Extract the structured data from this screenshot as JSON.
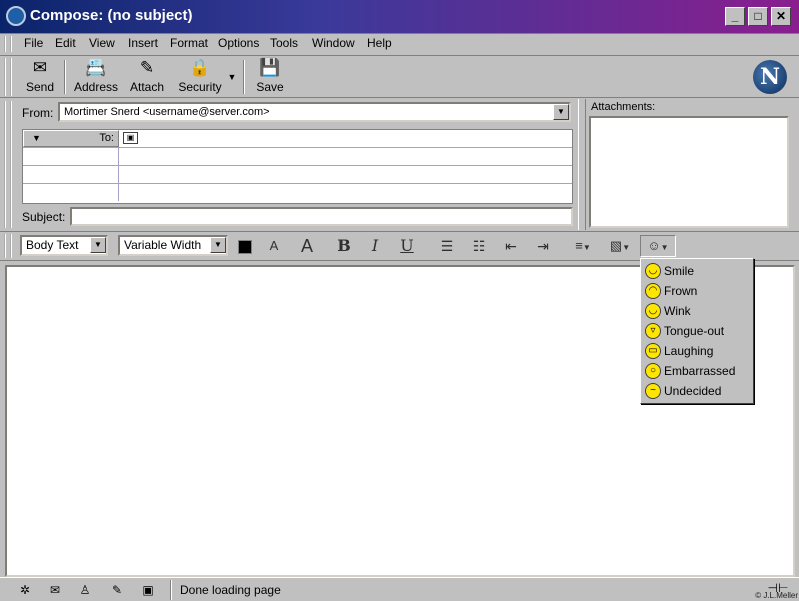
{
  "window": {
    "title": "Compose: (no subject)",
    "minimize": "_",
    "maximize": "□",
    "close": "✕"
  },
  "menu": [
    "File",
    "Edit",
    "View",
    "Insert",
    "Format",
    "Options",
    "Tools",
    "Window",
    "Help"
  ],
  "toolbar": {
    "send": "Send",
    "address": "Address",
    "attach": "Attach",
    "security": "Security",
    "save": "Save",
    "logo": "N"
  },
  "address": {
    "from_label": "From:",
    "from_value": "Mortimer Snerd <username@server.com>",
    "to_label": "To:",
    "subject_label": "Subject:",
    "subject_value": ""
  },
  "attachments": {
    "label": "Attachments:"
  },
  "format": {
    "paragraph_style": "Body Text",
    "font": "Variable Width",
    "bold": "B",
    "italic": "I",
    "underline": "U",
    "decrease_font": "A",
    "increase_font": "A"
  },
  "emoticons": {
    "items": [
      "Smile",
      "Frown",
      "Wink",
      "Tongue-out",
      "Laughing",
      "Embarrassed",
      "Undecided"
    ],
    "face_color": "#ffe600"
  },
  "status": {
    "text": "Done loading page",
    "copyright": "© J.L.Meller"
  },
  "colors": {
    "titlebar_start": "#0a246a",
    "titlebar_end": "#8a1e8e",
    "chrome": "#c0c0c0"
  }
}
